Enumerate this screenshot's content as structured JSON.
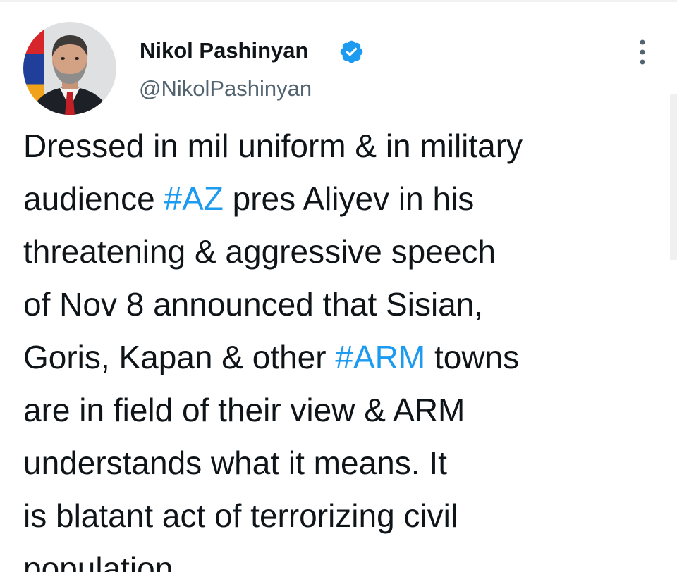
{
  "tweet": {
    "author_name": "Nikol Pashinyan",
    "author_handle": "@NikolPashinyan",
    "lines": {
      "l1": "Dressed in mil uniform & in military",
      "l2a": "audience ",
      "l2b": "#AZ",
      "l2c": " pres Aliyev in his",
      "l3": "threatening & aggressive speech",
      "l4": "of Nov 8 announced that Sisian,",
      "l5a": "Goris, Kapan & other ",
      "l5b": "#ARM",
      "l5c": " towns",
      "l6": "are in field of their view & ARM",
      "l7": "understands what it means. It",
      "l8": "is blatant act of terrorizing civil",
      "l9": "population."
    }
  },
  "icons": {
    "verified": "verified-badge-icon",
    "more": "more-options-icon"
  },
  "colors": {
    "text": "#0f1419",
    "secondary": "#536471",
    "link": "#1d9bf0"
  }
}
